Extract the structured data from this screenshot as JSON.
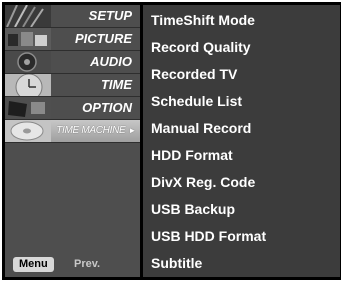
{
  "left_menu": {
    "items": [
      {
        "label": "SETUP",
        "thumbnail": "setup-thumbnail"
      },
      {
        "label": "PICTURE",
        "thumbnail": "picture-thumbnail"
      },
      {
        "label": "AUDIO",
        "thumbnail": "audio-thumbnail"
      },
      {
        "label": "TIME",
        "thumbnail": "clock-thumbnail"
      },
      {
        "label": "OPTION",
        "thumbnail": "option-thumbnail"
      },
      {
        "label": "TIME MACHINE",
        "thumbnail": "disc-thumbnail",
        "selected": true,
        "arrow": "►"
      }
    ],
    "footer": {
      "menu_key": "Menu",
      "action": "Prev."
    }
  },
  "submenu": {
    "items": [
      "TimeShift Mode",
      "Record Quality",
      "Recorded TV",
      "Schedule List",
      "Manual Record",
      "HDD Format",
      "DivX Reg. Code",
      "USB Backup",
      "USB HDD Format",
      "Subtitle"
    ]
  },
  "colors": {
    "frame": "#000000",
    "left_panel": "#4e4e4e",
    "right_panel": "#3c3c3c",
    "selected_item": "#b3b3b3",
    "text": "#ffffff"
  }
}
